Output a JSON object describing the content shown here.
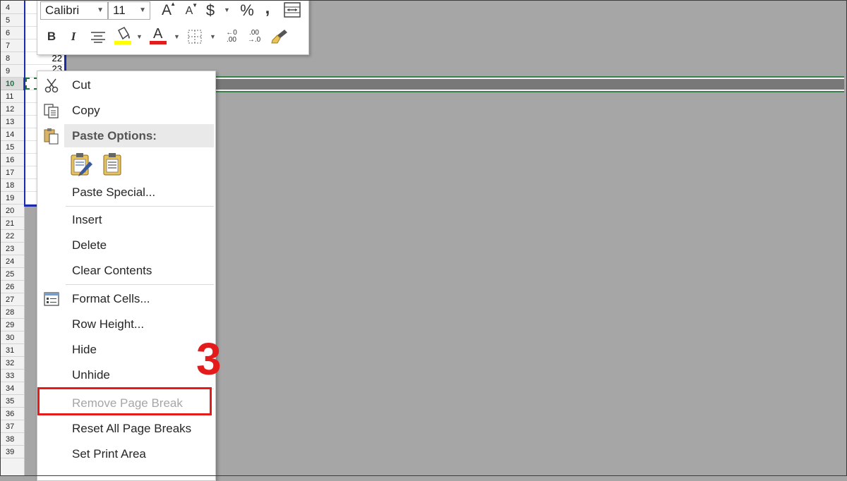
{
  "toolbar": {
    "font_name": "Calibri",
    "font_size": "11",
    "grow_font_glyph": "A",
    "shrink_font_glyph": "A",
    "currency_glyph": "$",
    "percent_glyph": "%",
    "comma_glyph": ",",
    "bold_glyph": "B",
    "italic_glyph": "I",
    "font_color_glyph": "A",
    "inc_decimal_top": "←0",
    "inc_decimal_bottom": ".00",
    "dec_decimal_top": ".00",
    "dec_decimal_bottom": "→.0",
    "fill_color": "#ffff00",
    "font_color": "#e31b1b"
  },
  "sheet": {
    "row_numbers": [
      "4",
      "5",
      "6",
      "7",
      "8",
      "9",
      "10",
      "11",
      "12",
      "13",
      "14",
      "15",
      "16",
      "17",
      "18",
      "19",
      "20",
      "21",
      "22",
      "23",
      "24",
      "25",
      "26",
      "27",
      "28",
      "29",
      "30",
      "31",
      "32",
      "33",
      "34",
      "35",
      "36",
      "37",
      "38",
      "39"
    ],
    "active_row": "10",
    "cell_value_row8": "22",
    "cell_value_row9": "23"
  },
  "context_menu": {
    "cut": "Cut",
    "copy": "Copy",
    "paste_options": "Paste Options:",
    "paste_special": "Paste Special...",
    "insert": "Insert",
    "delete": "Delete",
    "clear_contents": "Clear Contents",
    "format_cells": "Format Cells...",
    "row_height": "Row Height...",
    "hide": "Hide",
    "unhide": "Unhide",
    "remove_page_break": "Remove Page Break",
    "reset_all_page_breaks": "Reset All Page Breaks",
    "set_print_area": "Set Print Area"
  },
  "annotation": {
    "step_number": "3",
    "color": "#e31b1b"
  },
  "colors": {
    "excel_green": "#217346",
    "page_area_border": "#1a2aa8",
    "background_gray": "#a6a6a6"
  }
}
